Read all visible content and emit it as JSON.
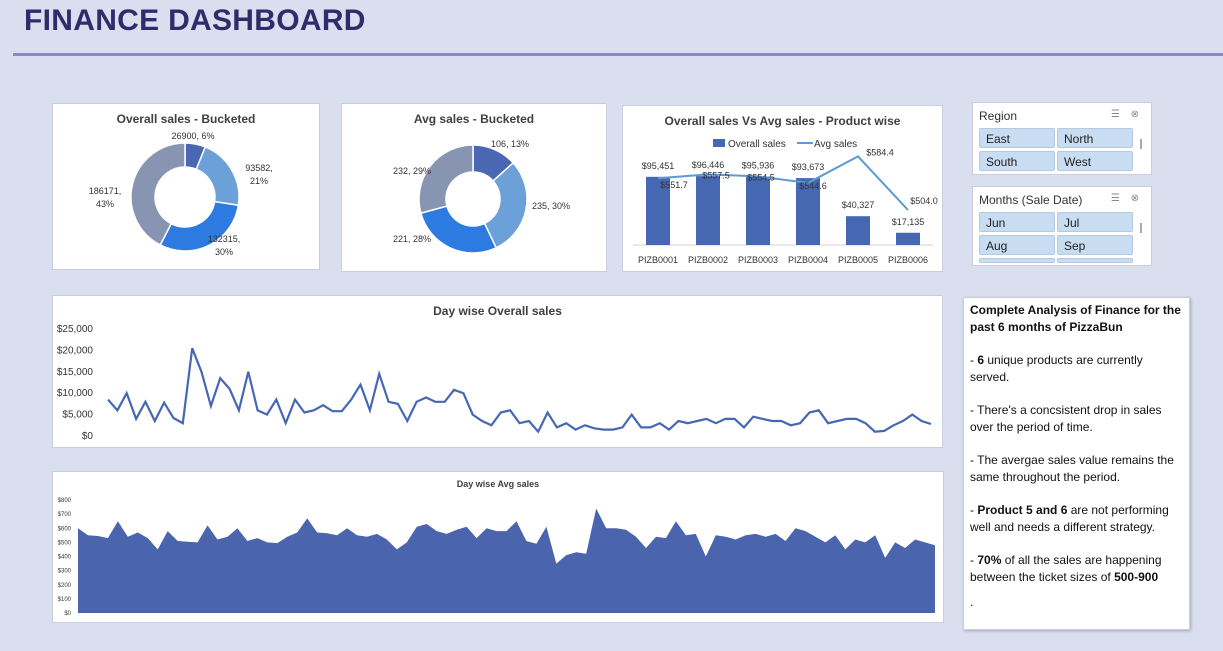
{
  "header": {
    "title": "FINANCE DASHBOARD"
  },
  "colors": {
    "background": "#dadff0",
    "title": "#2e2d6b",
    "rule": "#8a88c8",
    "bar": "#4668b3",
    "line": "#5b9bd5",
    "area": "#4b64ae"
  },
  "chart_data": [
    {
      "type": "pie",
      "title": "Overall sales - Bucketed",
      "slices": [
        {
          "value": 26900,
          "label": "26900, 6%",
          "color": "#4a67b3"
        },
        {
          "value": 93582,
          "label": "93582, 21%",
          "color": "#6ca0d8"
        },
        {
          "value": 132315,
          "label": "132315, 30%",
          "color": "#2d7be0"
        },
        {
          "value": 186171,
          "label": "186171, 43%",
          "color": "#8795b2"
        }
      ]
    },
    {
      "type": "pie",
      "title": "Avg sales - Bucketed",
      "slices": [
        {
          "value": 106,
          "label": "106, 13%",
          "color": "#4a67b3"
        },
        {
          "value": 235,
          "label": "235, 30%",
          "color": "#6ca0d8"
        },
        {
          "value": 221,
          "label": "221, 28%",
          "color": "#2d7be0"
        },
        {
          "value": 232,
          "label": "232, 29%",
          "color": "#8795b2"
        }
      ]
    },
    {
      "type": "bar",
      "title": "Overall sales Vs Avg sales - Product wise",
      "legend": [
        "Overall sales",
        "Avg sales"
      ],
      "categories": [
        "PIZB0001",
        "PIZB0002",
        "PIZB0003",
        "PIZB0004",
        "PIZB0005",
        "PIZB0006"
      ],
      "series": [
        {
          "name": "Overall sales",
          "values": [
            95451,
            96446,
            95936,
            93673,
            40327,
            17135
          ],
          "labels": [
            "$95,451",
            "$96,446",
            "$95,936",
            "$93,673",
            "$40,327",
            "$17,135"
          ]
        },
        {
          "name": "Avg sales",
          "values": [
            551.7,
            557.5,
            554.5,
            544.6,
            584.4,
            504.0
          ],
          "labels": [
            "$551.7",
            "$557.5",
            "$554.5",
            "$544.6",
            "$584.4",
            "$504.0"
          ]
        }
      ]
    },
    {
      "type": "line",
      "title": "Day wise Overall sales",
      "yticks": [
        "$25,000",
        "$20,000",
        "$15,000",
        "$10,000",
        "$5,000",
        "$0"
      ],
      "ylim": [
        0,
        25000
      ],
      "values": [
        8500,
        6000,
        10000,
        4000,
        8000,
        3500,
        7800,
        4200,
        3000,
        20500,
        15000,
        7000,
        13500,
        11000,
        6000,
        15000,
        6000,
        5000,
        8500,
        3000,
        8500,
        5500,
        6000,
        7200,
        5800,
        5800,
        8500,
        12000,
        6000,
        14500,
        8000,
        7500,
        3500,
        8000,
        9000,
        8000,
        8000,
        10800,
        10000,
        5000,
        3500,
        2500,
        5500,
        6000,
        3000,
        3500,
        1000,
        5500,
        2000,
        3000,
        1500,
        2500,
        1800,
        1500,
        1500,
        2000,
        5000,
        2000,
        2000,
        3000,
        1500,
        3500,
        3000,
        3500,
        4000,
        3000,
        4000,
        4000,
        2000,
        4500,
        4000,
        3500,
        3500,
        2500,
        3000,
        5500,
        6000,
        3000,
        3500,
        4000,
        4000,
        3000,
        1000,
        1200,
        2500,
        3500,
        5000,
        3500,
        2800
      ]
    },
    {
      "type": "area",
      "title": "Day wise Avg sales",
      "yticks": [
        "$800",
        "$700",
        "$600",
        "$500",
        "$400",
        "$300",
        "$200",
        "$100",
        "$0"
      ],
      "ylim": [
        0,
        800
      ],
      "values": [
        600,
        550,
        545,
        530,
        650,
        540,
        570,
        530,
        450,
        580,
        510,
        505,
        500,
        620,
        520,
        540,
        600,
        510,
        530,
        500,
        495,
        540,
        570,
        670,
        570,
        565,
        550,
        600,
        550,
        540,
        560,
        520,
        450,
        500,
        610,
        630,
        580,
        560,
        590,
        610,
        530,
        600,
        580,
        580,
        650,
        510,
        490,
        610,
        350,
        410,
        430,
        420,
        740,
        600,
        600,
        590,
        540,
        460,
        540,
        530,
        650,
        550,
        560,
        400,
        550,
        540,
        520,
        550,
        560,
        540,
        560,
        510,
        600,
        580,
        540,
        500,
        550,
        450,
        520,
        500,
        550,
        390,
        500,
        460,
        520,
        500,
        480
      ]
    }
  ],
  "slicers": [
    {
      "title": "Region",
      "items": [
        "East",
        "North",
        "South",
        "West"
      ]
    },
    {
      "title": "Months (Sale Date)",
      "items": [
        "Jun",
        "Jul",
        "Aug",
        "Sep"
      ]
    }
  ],
  "notes": {
    "heading": "Complete Analysis of Finance for the past 6 months of PizzaBun",
    "b1_bold": "6",
    "b1_rest": " unique products are currently served.",
    "b2": "- There's a concsistent drop in sales over the period of time.",
    "b3": "- The avergae sales value remains the same throughout the period.",
    "b4_bold": "Product 5 and 6",
    "b4_rest": " are not performing well and needs a different strategy.",
    "b5_bold": "70%",
    "b5_mid": " of all the sales are happening between the ticket sizes of ",
    "b5_tail": "500-900",
    "b6": "."
  }
}
